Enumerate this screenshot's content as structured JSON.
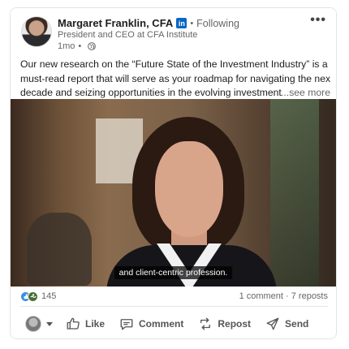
{
  "author": {
    "name": "Margaret Franklin, CFA",
    "badge": "in",
    "follow_status": "Following",
    "headline": "President and CEO at CFA Institute",
    "time": "1mo",
    "visibility_icon": "globe-icon"
  },
  "more_icon": "•••",
  "post": {
    "line1": "Our new research on the “Future State of the Investment Industry” is a",
    "line2": "must-read report that will serve as your roadmap for navigating the next",
    "line3": "decade and seizing opportunities in the evolving investment",
    "see_more": "...see more"
  },
  "video": {
    "caption": "and client-centric profession."
  },
  "social": {
    "reactions_count": "145",
    "reaction_icons": [
      "like-reaction-icon",
      "support-reaction-icon"
    ],
    "comments_reposts": "1 comment · 7 reposts"
  },
  "actions": {
    "like": "Like",
    "comment": "Comment",
    "repost": "Repost",
    "send": "Send"
  },
  "colors": {
    "brand": "#0a66c2",
    "like_reaction": "#378fe9",
    "support_reaction": "#44712e"
  }
}
